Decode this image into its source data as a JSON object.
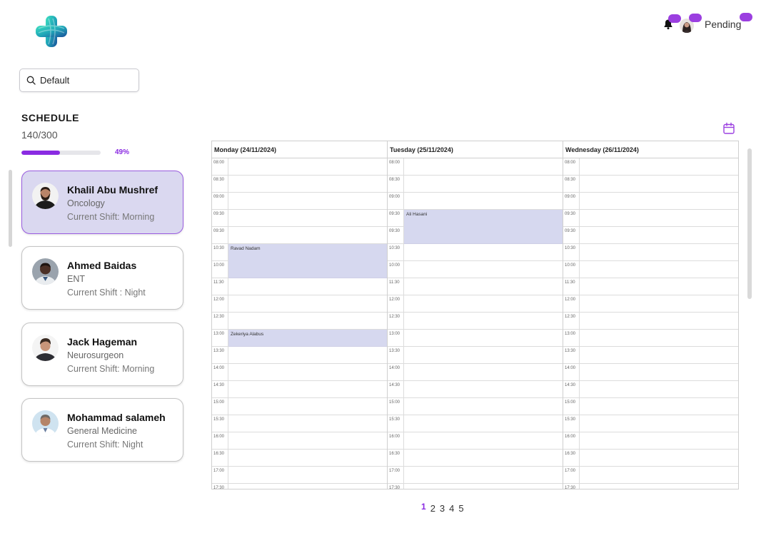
{
  "header": {
    "logo_icon": "medical-cross-logo-icon",
    "notification_icon": "bell-icon",
    "status_text": "Pending",
    "accent_color": "#9b3fe0"
  },
  "search": {
    "value": "Default",
    "icon": "search-icon"
  },
  "schedule": {
    "title": "SCHEDULE",
    "count": "140/300",
    "progress_percent": 49,
    "progress_label": "49%"
  },
  "doctors": [
    {
      "name": "Khalil Abu Mushref",
      "department": "Oncology",
      "shift": "Current Shift: Morning",
      "active": true
    },
    {
      "name": "Ahmed Baidas",
      "department": "ENT",
      "shift": "Current Shift : Night",
      "active": false
    },
    {
      "name": "Jack Hageman",
      "department": "Neurosurgeon",
      "shift": "Current Shift: Morning",
      "active": false
    },
    {
      "name": "Mohammad salameh",
      "department": "General Medicine",
      "shift": "Current Shift: Night",
      "active": false
    }
  ],
  "calendar": {
    "icon": "calendar-icon",
    "days": [
      "Monday (24/11/2024)",
      "Tuesday (25/11/2024)",
      "Wednesday (26/11/2024)"
    ],
    "times": [
      "08:00",
      "08:30",
      "09:00",
      "09:30",
      "09:30",
      "10:30",
      "10:00",
      "11:30",
      "12:00",
      "12:30",
      "13:00",
      "13:30",
      "14:00",
      "14:30",
      "15:00",
      "15:30",
      "16:00",
      "16:30",
      "17:00",
      "17:30"
    ],
    "events": [
      {
        "day": 0,
        "slot": 5,
        "span": 2,
        "label": "Ravad Nadam"
      },
      {
        "day": 0,
        "slot": 10,
        "span": 1,
        "label": "Zekeriya Alabus"
      },
      {
        "day": 1,
        "slot": 3,
        "span": 2,
        "label": "Ali Hasani"
      }
    ],
    "event_color": "#d6d8ef"
  },
  "pagination": {
    "pages": [
      "1",
      "2",
      "3",
      "4",
      "5"
    ],
    "current": "1"
  }
}
